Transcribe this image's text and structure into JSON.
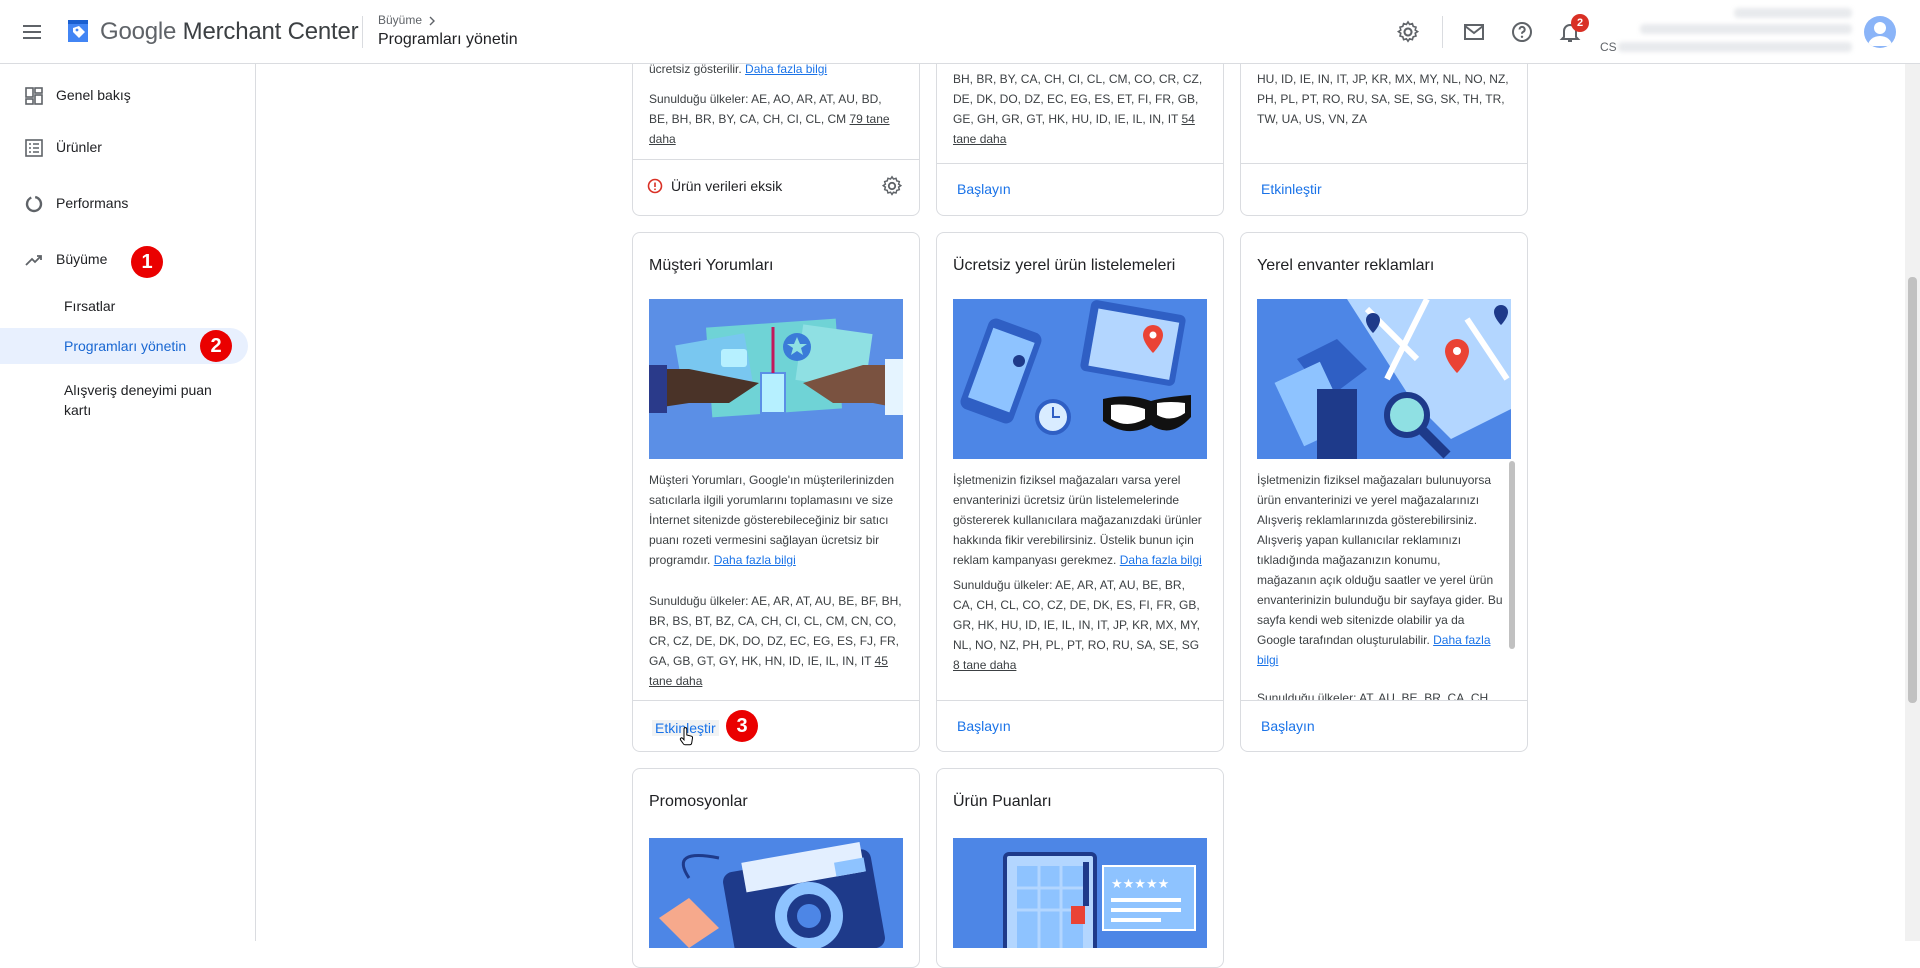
{
  "header": {
    "app_name_google": "Google",
    "app_name_product": "Merchant Center",
    "breadcrumb_parent": "Büyüme",
    "breadcrumb_separator": ">",
    "page_title": "Programları yönetin",
    "notification_count": "2",
    "account_prefix": "CS"
  },
  "sidebar": {
    "items": [
      {
        "label": "Genel bakış",
        "icon": "dashboard-icon"
      },
      {
        "label": "Ürünler",
        "icon": "list-icon"
      },
      {
        "label": "Performans",
        "icon": "donut-chart-icon"
      },
      {
        "label": "Büyüme",
        "icon": "trending-up-icon"
      }
    ],
    "sub_items": [
      {
        "label": "Fırsatlar"
      },
      {
        "label": "Programları yönetin",
        "active": true
      },
      {
        "label": "Alışveriş deneyimi puan kartı"
      }
    ]
  },
  "steps": {
    "one": "1",
    "two": "2",
    "three": "3"
  },
  "cards_top": [
    {
      "desc_tail": "ücretsiz gösterilir.",
      "link": "Daha fazla bilgi",
      "countries_prefix": "Sunulduğu ülkeler:",
      "countries": "AE, AO, AR, AT, AU, BD, BE, BH, BR, BY, CA, CH, CI, CL, CM",
      "more": "79 tane daha",
      "warning": "Ürün verileri eksik"
    },
    {
      "countries": "BH, BR, BY, CA, CH, CI, CL, CM, CO, CR, CZ, DE, DK, DO, DZ, EC, EG, ES, ET, FI, FR, GB, GE, GH, GR, GT, HK, HU, ID, IE, IL, IN, IT",
      "more": "54 tane daha",
      "action": "Başlayın"
    },
    {
      "countries": "HU, ID, IE, IN, IT, JP, KR, MX, MY, NL, NO, NZ, PH, PL, PT, RO, RU, SA, SE, SG, SK, TH, TR, TW, UA, US, VN, ZA",
      "action": "Etkinleştir"
    }
  ],
  "cards_mid": [
    {
      "title": "Müşteri Yorumları",
      "desc": "Müşteri Yorumları, Google'ın müşterilerinizden satıcılarla ilgili yorumlarını toplamasını ve size İnternet sitenizde gösterebileceğiniz bir satıcı puanı rozeti vermesini sağlayan ücretsiz bir programdır.",
      "link": "Daha fazla bilgi",
      "countries_prefix": "Sunulduğu ülkeler:",
      "countries": "AE, AR, AT, AU, BE, BF, BH, BR, BS, BT, BZ, CA, CH, CI, CL, CM, CN, CO, CR, CZ, DE, DK, DO, DZ, EC, EG, ES, FJ, FR, GA, GB, GT, GY, HK, HN, ID, IE, IL, IN, IT",
      "more": "45 tane daha",
      "action": "Etkinleştir"
    },
    {
      "title": "Ücretsiz yerel ürün listelemeleri",
      "desc": "İşletmenizin fiziksel mağazaları varsa yerel envanterinizi ücretsiz ürün listelemelerinde göstererek kullanıcılara mağazanızdaki ürünler hakkında fikir verebilirsiniz. Üstelik bunun için reklam kampanyası gerekmez.",
      "link": "Daha fazla bilgi",
      "countries_prefix": "Sunulduğu ülkeler:",
      "countries": "AE, AR, AT, AU, BE, BR, CA, CH, CL, CO, CZ, DE, DK, ES, FI, FR, GB, GR, HK, HU, ID, IE, IL, IN, IT, JP, KR, MX, MY, NL, NO, NZ, PH, PL, PT, RO, RU, SA, SE, SG",
      "more": "8 tane daha",
      "action": "Başlayın"
    },
    {
      "title": "Yerel envanter reklamları",
      "desc": "İşletmenizin fiziksel mağazaları bulunuyorsa ürün envanterinizi ve yerel mağazalarınızı Alışveriş reklamlarınızda gösterebilirsiniz. Alışveriş yapan kullanıcılar reklamınızı tıkladığında mağazanızın konumu, mağazanın açık olduğu saatler ve yerel ürün envanterinizin bulunduğu bir sayfaya gider. Bu sayfa kendi web sitenizde olabilir ya da Google tarafından oluşturulabilir.",
      "link": "Daha fazla bilgi",
      "countries_prefix": "Sunulduğu ülkeler:",
      "countries": "AT, AU, BE, BR, CA, CH, DE",
      "action": "Başlayın"
    }
  ],
  "cards_bottom": [
    {
      "title": "Promosyonlar"
    },
    {
      "title": "Ürün Puanları"
    }
  ]
}
